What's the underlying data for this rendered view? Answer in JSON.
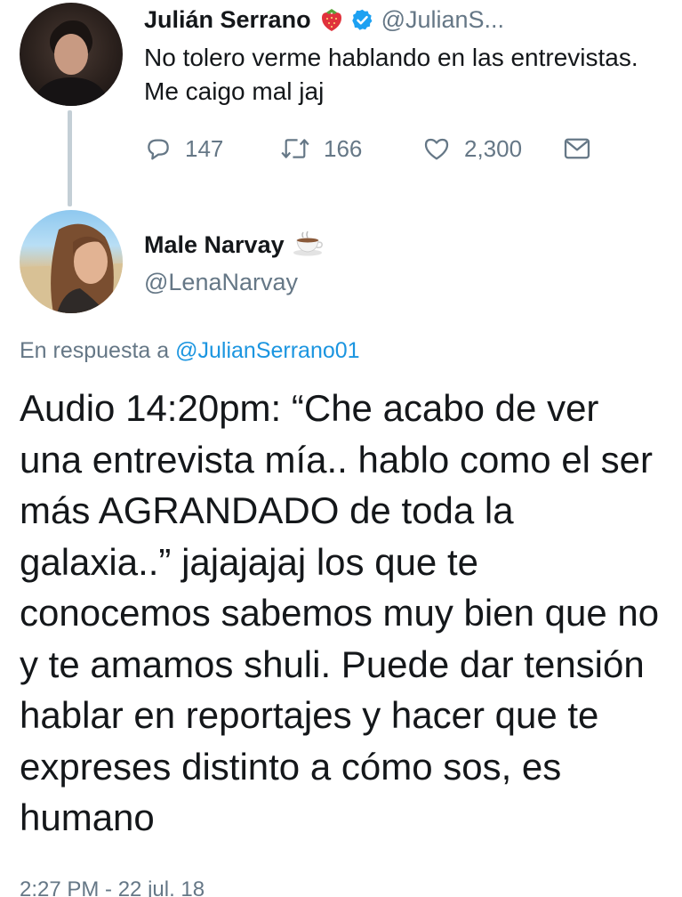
{
  "parent_tweet": {
    "author_name": "Julián Serrano",
    "handle": "@JulianS...",
    "text": "No tolero verme hablando en las entrevistas. Me caigo mal jaj",
    "replies_count": "147",
    "retweets_count": "166",
    "likes_count": "2,300",
    "badges": [
      "strawberry-emoji",
      "verified-badge"
    ]
  },
  "reply_tweet": {
    "author_name": "Male Narvay",
    "handle": "@LenaNarvay",
    "in_reply_prefix": "En respuesta a",
    "in_reply_mention": "@JulianSerrano01",
    "text": "Audio 14:20pm: “Che acabo de ver una entrevista mía.. hablo como el ser más AGRANDADO de toda la galaxia..” jajajajaj los que te conocemos sabemos muy bien que no y te amamos shuli. Puede dar tensión hablar en reportajes y hacer que te expreses distinto a cómo sos, es humano",
    "timestamp": "2:27 PM - 22 jul. 18",
    "name_emoji": "coffee-emoji"
  },
  "colors": {
    "text_primary": "#14171a",
    "text_secondary": "#657786",
    "link": "#1b95e0",
    "verified": "#1da1f2",
    "thread_line": "#c4cfd6"
  }
}
